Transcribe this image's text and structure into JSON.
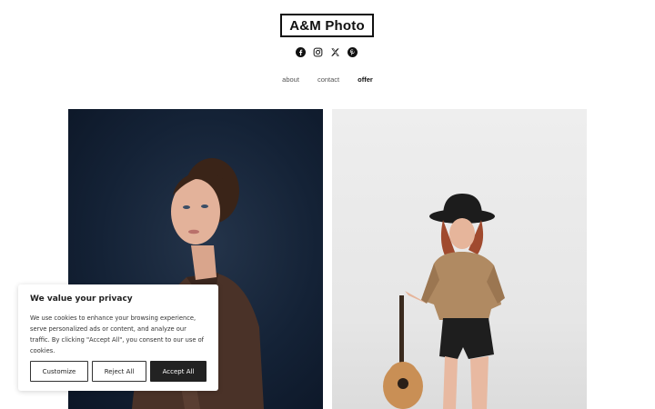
{
  "header": {
    "logo_text": "A&M Photo"
  },
  "social": [
    {
      "icon": "facebook-icon"
    },
    {
      "icon": "instagram-icon"
    },
    {
      "icon": "x-twitter-icon"
    },
    {
      "icon": "pinterest-icon"
    }
  ],
  "nav": {
    "items": [
      {
        "label": "about"
      },
      {
        "label": "contact"
      },
      {
        "label": "offer",
        "active": true
      }
    ]
  },
  "cookie_banner": {
    "title": "We value your privacy",
    "text": "We use cookies to enhance your browsing experience, serve personalized ads or content, and analyze our traffic. By clicking \"Accept All\", you consent to our use of cookies.",
    "customize_label": "Customize",
    "reject_label": "Reject All",
    "accept_label": "Accept All"
  },
  "colors": {
    "text": "#111111",
    "accept_bg": "#222222",
    "left_photo_bg": "#142236",
    "right_photo_bg": "#eeeeee"
  }
}
